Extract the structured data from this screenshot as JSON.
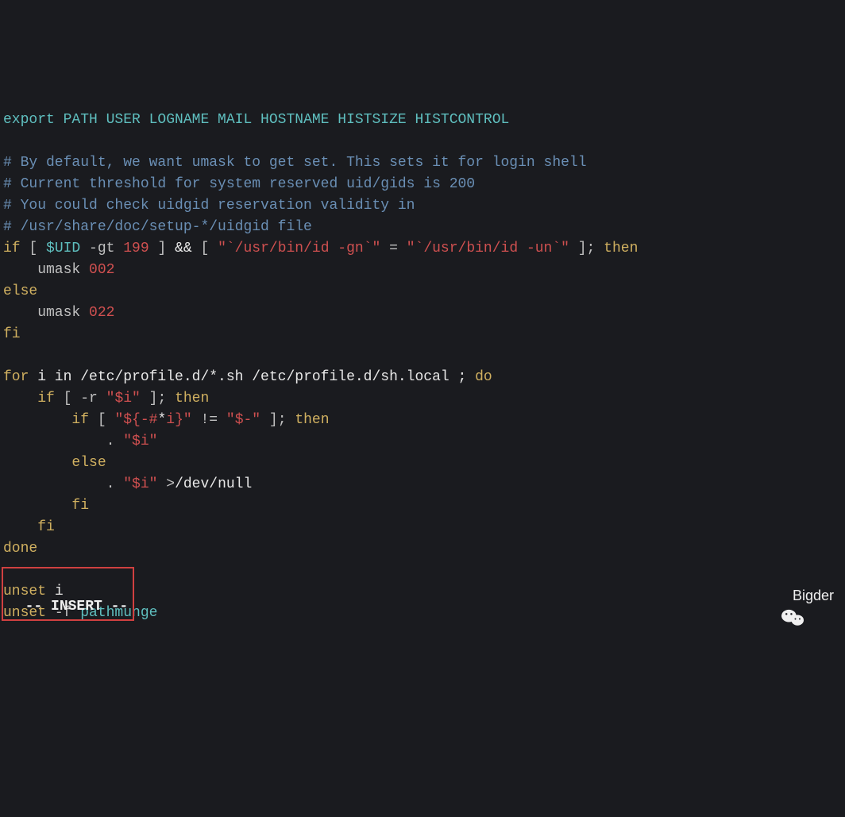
{
  "code": {
    "l1_export": "export",
    "l1_vars": " PATH USER LOGNAME MAIL HOSTNAME HISTSIZE HISTCONTROL",
    "c1": "# By default, we want umask to get set. This sets it for login shell",
    "c2": "# Current threshold for system reserved uid/gids is 200",
    "c3": "# You could check uidgid reservation validity in",
    "c4": "# /usr/share/doc/setup-*/uidgid file",
    "if_kw": "if",
    "if_b1": " [ ",
    "if_uid": "$UID",
    "if_gt": " -gt ",
    "if_199": "199",
    "if_b2": " ] ",
    "if_and": "&&",
    "if_b3": " [ ",
    "if_s1": "\"`/usr/bin/id -gn`\"",
    "if_eq": " = ",
    "if_s2": "\"`/usr/bin/id -un`\"",
    "if_b4": " ]; ",
    "if_then": "then",
    "umask1_pad": "    umask ",
    "umask1_val": "002",
    "else_kw": "else",
    "umask2_pad": "    umask ",
    "umask2_val": "022",
    "fi_kw": "fi",
    "for_kw": "for",
    "for_mid": " i in /etc/profile.d/*.sh /etc/profile.d/sh.local ; ",
    "for_do": "do",
    "l_if2_pad": "    ",
    "l_if2_kw": "if",
    "l_if2_b1": " [ -r ",
    "l_if2_s": "\"$i\"",
    "l_if2_b2": " ]; ",
    "l_if2_then": "then",
    "l_if3_pad": "        ",
    "l_if3_kw": "if",
    "l_if3_b1": " [ ",
    "l_if3_s1a": "\"${-#",
    "l_if3_star": "*",
    "l_if3_s1b": "i}\"",
    "l_if3_neq": " != ",
    "l_if3_s2": "\"$-\"",
    "l_if3_b2": " ]; ",
    "l_if3_then": "then",
    "dot1_pad": "            . ",
    "dot1_s": "\"$i\"",
    "else2_pad": "        ",
    "else2_kw": "else",
    "dot2_pad": "            . ",
    "dot2_s": "\"$i\"",
    "dot2_gt": " >",
    "dot2_dev": "/dev/null",
    "fi2_pad": "        ",
    "fi2_kw": "fi",
    "fi3_pad": "    ",
    "fi3_kw": "fi",
    "done_kw": "done",
    "unset1_kw": "unset",
    "unset1_v": " i",
    "unset2_kw": "unset",
    "unset2_f": " -f",
    "unset2_v": " pathmunge"
  },
  "mode_indicator": "-- INSERT --",
  "watermark_text": "Bigder"
}
